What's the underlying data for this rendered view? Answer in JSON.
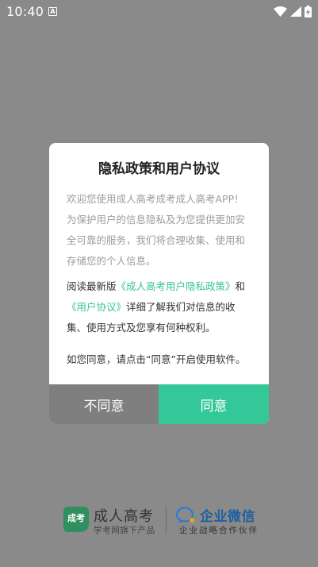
{
  "status_bar": {
    "time": "10:40",
    "notification_glyph": "A"
  },
  "dialog": {
    "title": "隐私政策和用户协议",
    "intro": "欢迎您使用成人高考成考成人高考APP！为保护用户的信息隐私及为您提供更加安全可靠的服务，我们将合理收集、使用和存储您的个人信息。",
    "links_prefix": "阅读最新版",
    "privacy_link": "《成人高考用户隐私政策》",
    "links_and": "和",
    "agreement_link": "《用户协议》",
    "links_suffix": "详细了解我们对信息的收集、使用方式及您享有何种权利。",
    "consent_text": "如您同意，请点击“同意”开启使用软件。",
    "disagree_label": "不同意",
    "agree_label": "同意"
  },
  "footer": {
    "brand_logo_text": "成考",
    "brand_name": "成人高考",
    "brand_sub": "学考网旗下产品",
    "partner_name": "企业微信",
    "partner_sub": "企业战略合作伙伴"
  },
  "colors": {
    "accent": "#34c898",
    "link": "#37c495",
    "disagree_bg": "#7f7f7f",
    "overlay": "#8a8a8a"
  }
}
